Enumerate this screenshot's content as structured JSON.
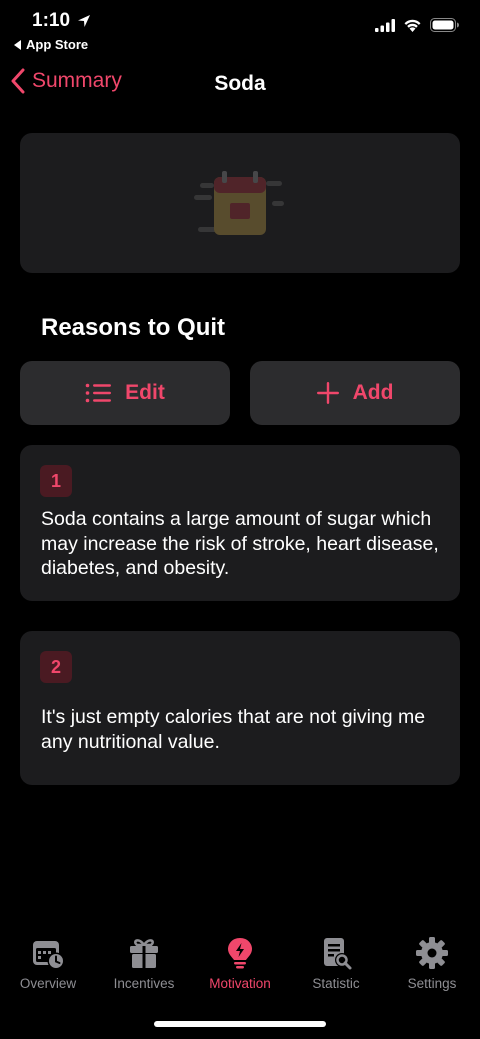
{
  "status": {
    "time": "1:10",
    "back_app": "App Store"
  },
  "nav": {
    "back_label": "Summary",
    "title": "Soda"
  },
  "section": {
    "title": "Reasons to Quit"
  },
  "actions": {
    "edit_label": "Edit",
    "add_label": "Add"
  },
  "reasons": [
    {
      "number": "1",
      "text": "Soda contains a large amount of sugar which may increase the risk of stroke, heart disease, diabetes, and obesity."
    },
    {
      "number": "2",
      "text": "It's just empty calories that are not giving me any nutritional value."
    }
  ],
  "tabs": [
    {
      "label": "Overview",
      "icon": "calendar-clock-icon"
    },
    {
      "label": "Incentives",
      "icon": "gift-icon"
    },
    {
      "label": "Motivation",
      "icon": "lightbulb-icon",
      "active": true
    },
    {
      "label": "Statistic",
      "icon": "report-search-icon"
    },
    {
      "label": "Settings",
      "icon": "gear-icon"
    }
  ],
  "colors": {
    "accent": "#f0476b",
    "card": "#1c1c1e",
    "button": "#2c2c2e",
    "inactive": "#8e8e93"
  }
}
